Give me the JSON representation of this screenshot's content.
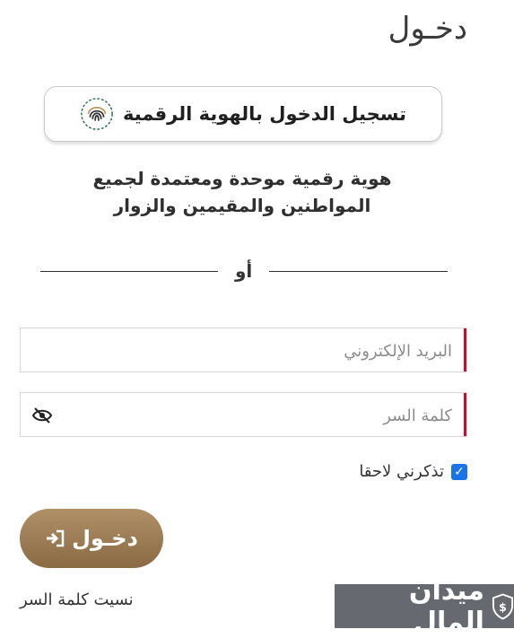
{
  "page": {
    "title": "دخـول"
  },
  "uae_pass": {
    "label": "تسجيل الدخول بالهوية الرقمية",
    "icon": "fingerprint-icon"
  },
  "description": {
    "line1": "هوية رقمية موحدة ومعتمدة لجميع",
    "line2": "المواطنين والمقيمين والزوار"
  },
  "divider": {
    "text": "أو"
  },
  "form": {
    "email": {
      "placeholder": "البريد الإلكتروني",
      "value": ""
    },
    "password": {
      "placeholder": "كلمة السر",
      "value": ""
    },
    "remember_label": "تذكرني لاحقا",
    "remember_checked": true,
    "login_label": "دخـول",
    "forgot_label": "نسيت كلمة السر"
  },
  "watermark": {
    "text": "ميدان المال"
  },
  "colors": {
    "accent_red": "#c8102e",
    "button_gold": "#9a7a52",
    "checkbox_blue": "#1a73e8",
    "watermark_bg": "#666a70"
  }
}
